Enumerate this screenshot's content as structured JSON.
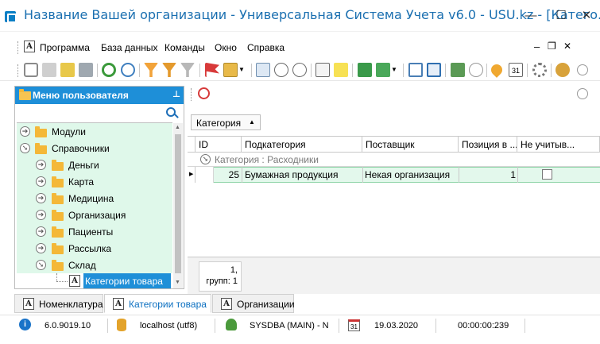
{
  "window": {
    "title": "Название Вашей организации - Универсальная Система Учета v6.0 - USU.kz - [Катего...",
    "minimize": "—",
    "maximize": "☐",
    "close": "✕"
  },
  "menu": {
    "items": [
      "Программа",
      "База данных",
      "Команды",
      "Окно",
      "Справка"
    ],
    "mdi_minimize": "–",
    "mdi_restore": "❐",
    "mdi_close": "✕"
  },
  "left_panel": {
    "title": "Меню пользователя",
    "pin": "⊥",
    "tree": [
      {
        "label": "Модули",
        "level": 0,
        "expanded": false
      },
      {
        "label": "Справочники",
        "level": 0,
        "expanded": true
      },
      {
        "label": "Деньги",
        "level": 1,
        "expanded": false
      },
      {
        "label": "Карта",
        "level": 1,
        "expanded": false
      },
      {
        "label": "Медицина",
        "level": 1,
        "expanded": false
      },
      {
        "label": "Организация",
        "level": 1,
        "expanded": false
      },
      {
        "label": "Пациенты",
        "level": 1,
        "expanded": false
      },
      {
        "label": "Рассылка",
        "level": 1,
        "expanded": false
      },
      {
        "label": "Склад",
        "level": 1,
        "expanded": true
      },
      {
        "label": "Категории товара",
        "level": 2,
        "selected": true
      }
    ]
  },
  "grid": {
    "group_by": "Категория",
    "columns": [
      "ID",
      "Подкатегория",
      "Поставщик",
      "Позиция в ...",
      "Не учитыв..."
    ],
    "group_row": "Категория : Расходники",
    "rows": [
      {
        "id": "25",
        "subcategory": "Бумажная продукция",
        "supplier": "Некая организация",
        "position": "1",
        "not_counted": false
      }
    ],
    "footer_count": "1,",
    "footer_groups": "групп: 1"
  },
  "tabs": [
    {
      "label": "Номенклатура",
      "active": false
    },
    {
      "label": "Категории товара",
      "active": true
    },
    {
      "label": "Организации",
      "active": false
    }
  ],
  "status": {
    "version": "6.0.9019.10",
    "database": "localhost (utf8)",
    "user": "SYSDBA (MAIN) - N",
    "date": "19.03.2020",
    "timer": "00:00:00:239"
  },
  "colors": {
    "accent": "#1e8fd8",
    "tree_bg": "#dff8ea",
    "selected_bg": "#1e8fd8",
    "row_bg": "#e3f8ec"
  }
}
